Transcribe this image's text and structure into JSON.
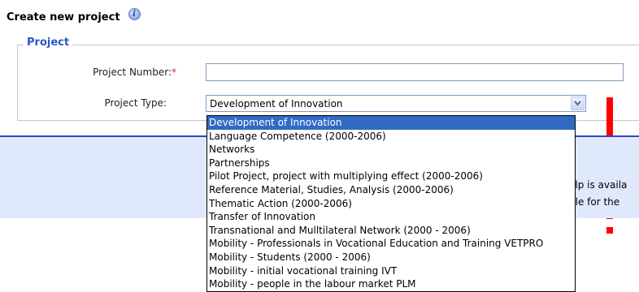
{
  "page": {
    "title": "Create new project",
    "info_icon": "info-icon"
  },
  "project_section": {
    "legend": "Project",
    "number_label": "Project Number:",
    "number_required_marker": "*",
    "number_value": "",
    "type_label": "Project Type:",
    "type_selected": "Development of Innovation"
  },
  "dropdown": {
    "options": [
      "Development of Innovation",
      "Language Competence (2000-2006)",
      "Networks",
      "Partnerships",
      "Pilot Project, project with multiplying effect (2000-2006)",
      "Reference Material, Studies, Analysis (2000-2006)",
      "Thematic Action (2000-2006)",
      "Transfer of Innovation",
      "Transnational and Mulltilateral Network (2000 - 2006)",
      "Mobility - Professionals in Vocational Education and Training VETPRO",
      "Mobility - Students (2000 - 2006)",
      "Mobility - initial vocational training IVT",
      "Mobility - people in the labour market PLM"
    ],
    "highlighted_index": 0
  },
  "help_panel": {
    "line_1": "elp is availa",
    "line_2": "ble for the"
  },
  "colors": {
    "legend": "#2a57c9",
    "separator": "#2d47c8",
    "help_bg": "#dfe9fb",
    "selection": "#316ac5",
    "annotation": "#ff0000",
    "required": "#e02a2a"
  }
}
